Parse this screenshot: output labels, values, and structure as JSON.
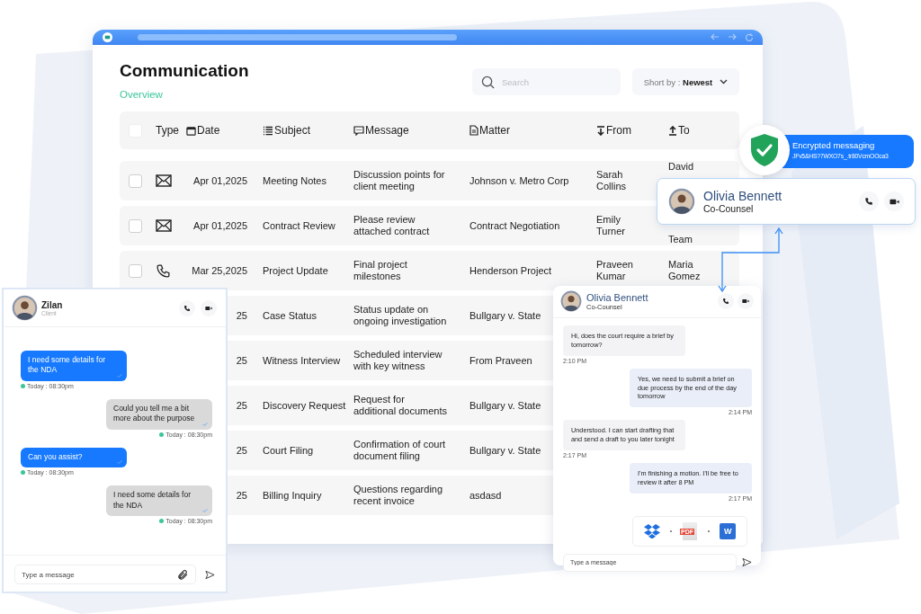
{
  "window": {
    "title": "Communication",
    "subtitle": "Overview",
    "search": {
      "placeholder": "Search"
    },
    "sort": "Short by : **Newest**"
  },
  "table": {
    "select_all_checked": false,
    "columns": [
      "Type",
      "Date",
      "Subject",
      "Message",
      "Matter",
      "From",
      "To"
    ],
    "rows": [
      {
        "checked": false,
        "kind": "mail",
        "date": "Apr 01,2025",
        "subject": "Meeting Notes",
        "message": "Discussion points for client meeting",
        "matter": "Johnson v. Metro Corp",
        "from": "Sarah Collins",
        "to": "David"
      },
      {
        "checked": false,
        "kind": "mail",
        "date": "Apr 01,2025",
        "subject": "Contract Review",
        "message": "Please review attached contract",
        "matter": "Contract Negotiation",
        "from": "Emily Turner",
        "to": "Team"
      },
      {
        "checked": false,
        "kind": "phone",
        "date": "Mar 25,2025",
        "subject": "Project Update",
        "message": "Final project milestones",
        "matter": "Henderson Project",
        "from": "Praveen Kumar",
        "to": "Maria Gomez"
      },
      {
        "date": "25",
        "subject": "Case Status",
        "message": "Status update on ongoing investigation",
        "matter": "Bullgary v. State"
      },
      {
        "date": "25",
        "subject": "Witness Interview",
        "message": "Scheduled interview with key witness",
        "matter": "From Praveen"
      },
      {
        "date": "25",
        "subject": "Discovery Request",
        "message": "Request for additional documents",
        "matter": "Bullgary v. State"
      },
      {
        "date": "25",
        "subject": "Court Filing",
        "message": "Confirmation of court document filing",
        "matter": "Bullgary v. State"
      },
      {
        "date": "25",
        "subject": "Billing Inquiry",
        "message": "Questions regarding recent invoice",
        "matter": "asdasd"
      }
    ]
  },
  "secure_badge": {
    "title": "Encrypted messaging",
    "code": "JFv5&HS?7WXO7s_.tr80VcmOOca3"
  },
  "contact_card": {
    "name": "Olivia Bennett",
    "role": "Co-Counsel"
  },
  "client_chat": {
    "name": "Zilan",
    "role": "Client",
    "messages": [
      {
        "kind": "left",
        "text": "I need some details for the NDA",
        "time": "Today : 08:30pm"
      },
      {
        "kind": "right",
        "text": "Could you tell me a bit more about the purpose",
        "time": "Today : 08:30pm"
      },
      {
        "kind": "left",
        "text": "Can you assist?",
        "time": "Today : 08:30pm"
      },
      {
        "kind": "right",
        "text": "I need some details for the NDA",
        "time": "Today : 08:30pm"
      }
    ],
    "input": {
      "placeholder": "Type a message"
    }
  },
  "counsel_chat": {
    "name": "Olivia Bennett",
    "role": "Co-Counsel",
    "messages": [
      {
        "kind": "left",
        "text": "Hi, does the court require a brief by tomorrow?",
        "time": "2:10 PM"
      },
      {
        "kind": "right",
        "text": "Yes, we need to submit a brief on due process by the end of the day tomorrow",
        "time": "2:14 PM"
      },
      {
        "kind": "left",
        "text": "Understood. I can start drafting that and send a draft to you later tonight",
        "time": "2:17 PM"
      },
      {
        "kind": "right",
        "text": "I'm finishing a motion. I'll be free to review it after 8 PM",
        "time": "2:17 PM"
      }
    ],
    "attachments": [
      {
        "kind": "dropbox"
      },
      {
        "kind": "pdf",
        "label": "PDF"
      },
      {
        "kind": "word",
        "label": "W"
      }
    ],
    "input": {
      "placeholder": "Type a message"
    }
  }
}
